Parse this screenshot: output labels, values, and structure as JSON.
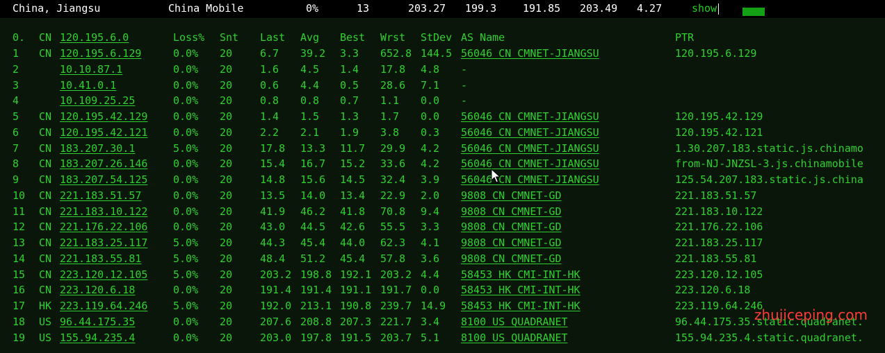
{
  "summary": {
    "location": "China, Jiangsu",
    "isp": "China Mobile",
    "loss": "0%",
    "snt": "13",
    "last": "203.27",
    "avg": "199.3",
    "best": "191.85",
    "wrst": "203.49",
    "stdev": "4.27",
    "action": "show"
  },
  "header": {
    "hop": "0.",
    "cc": "CN",
    "ip": "120.195.6.0",
    "loss": "Loss%",
    "snt": "Snt",
    "last": "Last",
    "avg": "Avg",
    "best": "Best",
    "wrst": "Wrst",
    "stdev": "StDev",
    "as": "AS Name",
    "ptr": "PTR"
  },
  "rows": [
    {
      "hop": "1",
      "cc": "CN",
      "ip": "120.195.6.129",
      "loss": "0.0%",
      "snt": "20",
      "last": "6.7",
      "avg": "39.2",
      "best": "3.3",
      "wrst": "652.8",
      "stdev": "144.5",
      "as": "56046 CN CMNET-JIANGSU",
      "ptr": "120.195.6.129"
    },
    {
      "hop": "2",
      "cc": "",
      "ip": "10.10.87.1",
      "loss": "0.0%",
      "snt": "20",
      "last": "1.6",
      "avg": "4.5",
      "best": "1.4",
      "wrst": "17.8",
      "stdev": "4.8",
      "as": "-",
      "ptr": ""
    },
    {
      "hop": "3",
      "cc": "",
      "ip": "10.41.0.1",
      "loss": "0.0%",
      "snt": "20",
      "last": "0.6",
      "avg": "4.4",
      "best": "0.5",
      "wrst": "28.6",
      "stdev": "7.1",
      "as": "-",
      "ptr": ""
    },
    {
      "hop": "4",
      "cc": "",
      "ip": "10.109.25.25",
      "loss": "0.0%",
      "snt": "20",
      "last": "0.8",
      "avg": "0.8",
      "best": "0.7",
      "wrst": "1.1",
      "stdev": "0.0",
      "as": "-",
      "ptr": ""
    },
    {
      "hop": "5",
      "cc": "CN",
      "ip": "120.195.42.129",
      "loss": "0.0%",
      "snt": "20",
      "last": "1.4",
      "avg": "1.5",
      "best": "1.3",
      "wrst": "1.7",
      "stdev": "0.0",
      "as": "56046 CN CMNET-JIANGSU",
      "ptr": "120.195.42.129"
    },
    {
      "hop": "6",
      "cc": "CN",
      "ip": "120.195.42.121",
      "loss": "0.0%",
      "snt": "20",
      "last": "2.2",
      "avg": "2.1",
      "best": "1.9",
      "wrst": "3.8",
      "stdev": "0.3",
      "as": "56046 CN CMNET-JIANGSU",
      "ptr": "120.195.42.121"
    },
    {
      "hop": "7",
      "cc": "CN",
      "ip": "183.207.30.1",
      "loss": "5.0%",
      "snt": "20",
      "last": "17.8",
      "avg": "13.3",
      "best": "11.7",
      "wrst": "29.9",
      "stdev": "4.2",
      "as": "56046 CN CMNET-JIANGSU",
      "ptr": "1.30.207.183.static.js.chinamo"
    },
    {
      "hop": "8",
      "cc": "CN",
      "ip": "183.207.26.146",
      "loss": "0.0%",
      "snt": "20",
      "last": "15.4",
      "avg": "16.7",
      "best": "15.2",
      "wrst": "33.6",
      "stdev": "4.2",
      "as": "56046 CN CMNET-JIANGSU",
      "ptr": "from-NJ-JNZSL-3.js.chinamobile"
    },
    {
      "hop": "9",
      "cc": "CN",
      "ip": "183.207.54.125",
      "loss": "0.0%",
      "snt": "20",
      "last": "14.8",
      "avg": "15.6",
      "best": "14.5",
      "wrst": "32.4",
      "stdev": "3.9",
      "as": "56046 CN CMNET-JIANGSU",
      "ptr": "125.54.207.183.static.js.china"
    },
    {
      "hop": "10",
      "cc": "CN",
      "ip": "221.183.51.57",
      "loss": "0.0%",
      "snt": "20",
      "last": "13.5",
      "avg": "14.0",
      "best": "13.4",
      "wrst": "22.9",
      "stdev": "2.0",
      "as": "9808  CN CMNET-GD",
      "ptr": "221.183.51.57"
    },
    {
      "hop": "11",
      "cc": "CN",
      "ip": "221.183.10.122",
      "loss": "0.0%",
      "snt": "20",
      "last": "41.9",
      "avg": "46.2",
      "best": "41.8",
      "wrst": "70.8",
      "stdev": "9.4",
      "as": "9808  CN CMNET-GD",
      "ptr": "221.183.10.122"
    },
    {
      "hop": "12",
      "cc": "CN",
      "ip": "221.176.22.106",
      "loss": "0.0%",
      "snt": "20",
      "last": "43.0",
      "avg": "44.5",
      "best": "42.6",
      "wrst": "55.5",
      "stdev": "3.3",
      "as": "9808  CN CMNET-GD",
      "ptr": "221.176.22.106"
    },
    {
      "hop": "13",
      "cc": "CN",
      "ip": "221.183.25.117",
      "loss": "5.0%",
      "snt": "20",
      "last": "44.3",
      "avg": "45.4",
      "best": "44.0",
      "wrst": "62.3",
      "stdev": "4.1",
      "as": "9808  CN CMNET-GD",
      "ptr": "221.183.25.117"
    },
    {
      "hop": "14",
      "cc": "CN",
      "ip": "221.183.55.81",
      "loss": "5.0%",
      "snt": "20",
      "last": "48.4",
      "avg": "51.2",
      "best": "45.4",
      "wrst": "57.8",
      "stdev": "3.6",
      "as": "9808  CN CMNET-GD",
      "ptr": "221.183.55.81"
    },
    {
      "hop": "15",
      "cc": "CN",
      "ip": "223.120.12.105",
      "loss": "5.0%",
      "snt": "20",
      "last": "203.2",
      "avg": "198.8",
      "best": "192.1",
      "wrst": "203.2",
      "stdev": "4.4",
      "as": "58453 HK CMI-INT-HK",
      "ptr": "223.120.12.105"
    },
    {
      "hop": "16",
      "cc": "CN",
      "ip": "223.120.6.18",
      "loss": "0.0%",
      "snt": "20",
      "last": "191.4",
      "avg": "191.4",
      "best": "191.1",
      "wrst": "191.7",
      "stdev": "0.0",
      "as": "58453 HK CMI-INT-HK",
      "ptr": "223.120.6.18"
    },
    {
      "hop": "17",
      "cc": "HK",
      "ip": "223.119.64.246",
      "loss": "5.0%",
      "snt": "20",
      "last": "192.0",
      "avg": "213.1",
      "best": "190.8",
      "wrst": "239.7",
      "stdev": "14.9",
      "as": "58453 HK CMI-INT-HK",
      "ptr": "223.119.64.246"
    },
    {
      "hop": "18",
      "cc": "US",
      "ip": "96.44.175.35",
      "loss": "0.0%",
      "snt": "20",
      "last": "207.6",
      "avg": "208.8",
      "best": "207.3",
      "wrst": "221.7",
      "stdev": "3.4",
      "as": "8100  US QUADRANET",
      "ptr": "96.44.175.35.static.quadranet."
    },
    {
      "hop": "19",
      "cc": "US",
      "ip": "155.94.235.4",
      "loss": "0.0%",
      "snt": "20",
      "last": "203.0",
      "avg": "197.8",
      "best": "191.5",
      "wrst": "203.7",
      "stdev": "5.1",
      "as": "8100  US QUADRANET",
      "ptr": "155.94.235.4.static.quadranet."
    }
  ],
  "watermark": "zhujiceping.com",
  "colors": {
    "text_green": "#2fd12f",
    "panel_bg": "#0a160a",
    "watermark": "#ff3a3a"
  },
  "icons": {
    "cursor": "mouse-pointer-icon"
  }
}
